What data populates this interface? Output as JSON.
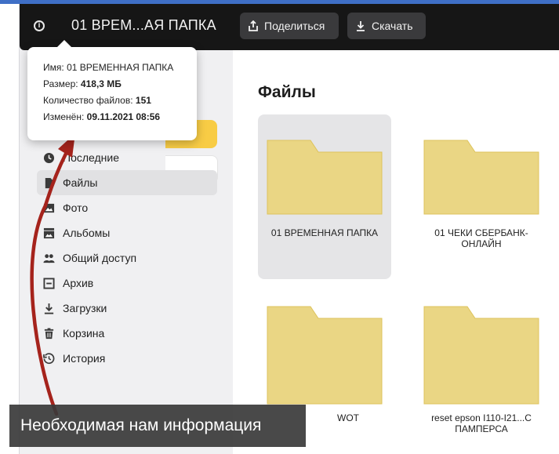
{
  "topbar": {
    "folder_name": "01 ВРЕМ...АЯ ПАПКА",
    "share_label": "Поделиться",
    "download_label": "Скачать"
  },
  "tooltip": {
    "name_label": "Имя:",
    "name_value": "01 ВРЕМЕННАЯ ПАПКА",
    "size_label": "Размер:",
    "size_value": "418,3 МБ",
    "count_label": "Количество файлов:",
    "count_value": "151",
    "modified_label": "Изменён:",
    "modified_value": "09.11.2021 08:56"
  },
  "sidebar": {
    "items": [
      {
        "label": "Последние",
        "icon": "clock-icon"
      },
      {
        "label": "Файлы",
        "icon": "file-icon",
        "active": true
      },
      {
        "label": "Фото",
        "icon": "photo-icon"
      },
      {
        "label": "Альбомы",
        "icon": "albums-icon"
      },
      {
        "label": "Общий доступ",
        "icon": "people-icon"
      },
      {
        "label": "Архив",
        "icon": "archive-icon"
      },
      {
        "label": "Загрузки",
        "icon": "download-icon"
      },
      {
        "label": "Корзина",
        "icon": "trash-icon"
      },
      {
        "label": "История",
        "icon": "history-icon"
      }
    ]
  },
  "main": {
    "title": "Файлы",
    "folders": [
      {
        "name": "01 ВРЕМЕННАЯ ПАПКА",
        "selected": true
      },
      {
        "name": "01 ЧЕКИ СБЕРБАНК-ОНЛАЙН"
      },
      {
        "name": "WOT"
      },
      {
        "name": "reset epson I110-I21...С ПАМПЕРСА"
      }
    ]
  },
  "annotation": {
    "caption": "Необходимая нам информация",
    "arrow_color": "#a5231c"
  },
  "colors": {
    "topbar": "#161616",
    "folder": "#ead684",
    "accent": "#f8cc45"
  }
}
